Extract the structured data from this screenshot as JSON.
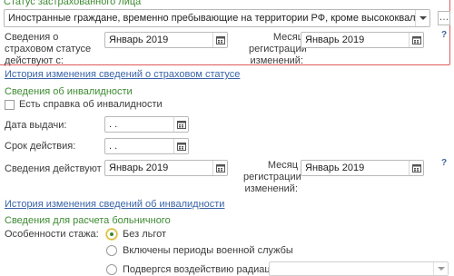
{
  "insured": {
    "section_title": "Статус застрахованного лица",
    "status_value": "Иностранные граждане, временно пребывающие на территории РФ, кроме высококвалифицированных",
    "info_label": "Сведения о страховом статусе действуют с:",
    "info_date": "Январь 2019",
    "month_label": "Месяц регистрации изменений:",
    "month_date": "Январь 2019",
    "help": "?",
    "history_link": "История изменения сведений о страховом статусе"
  },
  "disability": {
    "section_title": "Сведения об инвалидности",
    "checkbox_label": "Есть справка об инвалидности",
    "issue_label": "Дата выдачи:",
    "issue_value": " .  .",
    "valid_label": "Срок действия:",
    "valid_value": " .  .",
    "info_label": "Сведения действуют с:",
    "info_date": "Январь 2019",
    "month_label": "Месяц регистрации изменений:",
    "month_date": "Январь 2019",
    "help": "?",
    "history_link": "История изменения сведений об инвалидности"
  },
  "sick": {
    "section_title": "Сведения для расчета больничного",
    "features_label": "Особенности стажа:",
    "options": [
      "Без льгот",
      "Включены периоды военной службы",
      "Подвергся воздействию радиации"
    ]
  }
}
